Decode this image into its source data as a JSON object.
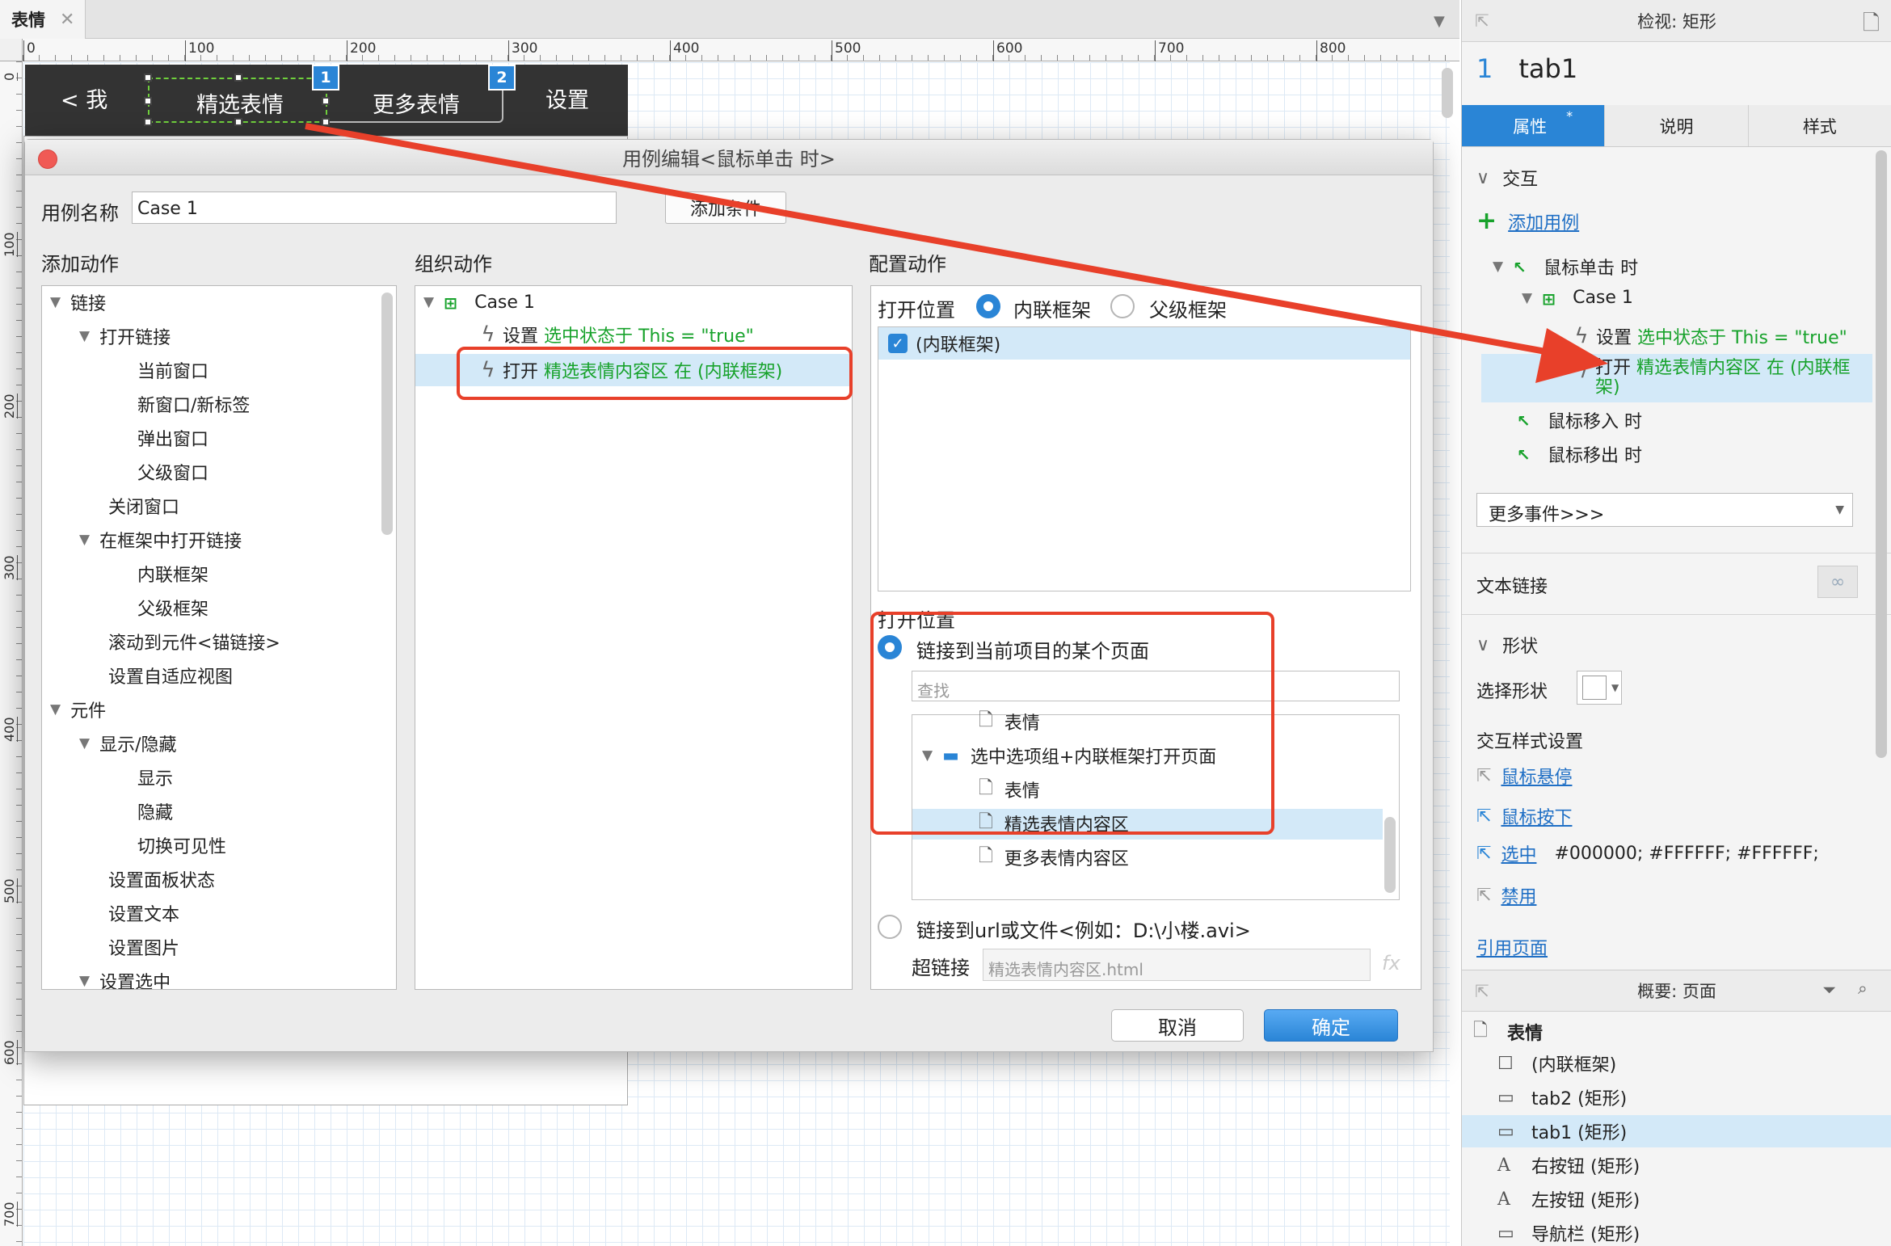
{
  "doc_tab": {
    "title": "表情",
    "close": "✕"
  },
  "ruler": {
    "h": [
      "0",
      "100",
      "200",
      "300",
      "400",
      "500",
      "600",
      "700",
      "800"
    ],
    "v": [
      "0",
      "100",
      "200",
      "300",
      "400",
      "500",
      "600",
      "700"
    ]
  },
  "navbar": {
    "back": "< 我",
    "tab1": "精选表情",
    "tab2": "更多表情",
    "settings": "设置",
    "badge1": "1",
    "badge2": "2"
  },
  "dialog": {
    "title": "用例编辑<鼠标单击 时>",
    "case_name_label": "用例名称",
    "case_name_value": "Case 1",
    "add_condition": "添加条件",
    "add_action_title": "添加动作",
    "org_action_title": "组织动作",
    "config_action_title": "配置动作",
    "add_actions": [
      {
        "label": "链接",
        "level": 0,
        "expanded": true
      },
      {
        "label": "打开链接",
        "level": 1,
        "expanded": true
      },
      {
        "label": "当前窗口",
        "level": 2
      },
      {
        "label": "新窗口/新标签",
        "level": 2
      },
      {
        "label": "弹出窗口",
        "level": 2
      },
      {
        "label": "父级窗口",
        "level": 2
      },
      {
        "label": "关闭窗口",
        "level": 1
      },
      {
        "label": "在框架中打开链接",
        "level": 1,
        "expanded": true
      },
      {
        "label": "内联框架",
        "level": 2
      },
      {
        "label": "父级框架",
        "level": 2
      },
      {
        "label": "滚动到元件<锚链接>",
        "level": 1
      },
      {
        "label": "设置自适应视图",
        "level": 1
      },
      {
        "label": "元件",
        "level": 0,
        "expanded": true
      },
      {
        "label": "显示/隐藏",
        "level": 1,
        "expanded": true
      },
      {
        "label": "显示",
        "level": 2
      },
      {
        "label": "隐藏",
        "level": 2
      },
      {
        "label": "切换可见性",
        "level": 2
      },
      {
        "label": "设置面板状态",
        "level": 1
      },
      {
        "label": "设置文本",
        "level": 1
      },
      {
        "label": "设置图片",
        "level": 1
      },
      {
        "label": "设置选中",
        "level": 1,
        "expanded": true
      }
    ],
    "org": {
      "case": "Case 1",
      "action1_verb": "设置",
      "action1_detail": "选中状态于 This = \"true\"",
      "action2_verb": "打开",
      "action2_detail": "精选表情内容区 在 (内联框架)"
    },
    "config": {
      "open_location_label": "打开位置",
      "opt_inline": "内联框架",
      "opt_parent": "父级框架",
      "frame_item": "(内联框架)",
      "open_location_label2": "打开位置",
      "link_page": "链接到当前项目的某个页面",
      "search_placeholder": "查找",
      "pages": [
        {
          "label": "表情",
          "type": "page",
          "level": 1
        },
        {
          "label": "选中选项组+内联框架打开页面",
          "type": "folder",
          "level": 0
        },
        {
          "label": "表情",
          "type": "page",
          "level": 1
        },
        {
          "label": "精选表情内容区",
          "type": "page",
          "level": 1,
          "selected": true
        },
        {
          "label": "更多表情内容区",
          "type": "page",
          "level": 1
        }
      ],
      "link_url": "链接到url或文件<例如：D:\\小楼.avi>",
      "hyperlink_label": "超链接",
      "hyperlink_placeholder": "精选表情内容区.html",
      "fx": "fx"
    },
    "cancel": "取消",
    "ok": "确定"
  },
  "inspector": {
    "title": "检视: 矩形",
    "num": "1",
    "name": "tab1",
    "tabs": [
      "属性",
      "说明",
      "样式"
    ],
    "tab_star": "*",
    "interaction": "交互",
    "add_case": "添加用例",
    "event_click": "鼠标单击 时",
    "case": "Case 1",
    "act1_verb": "设置",
    "act1_detail": "选中状态于 This = \"true\"",
    "act2_verb": "打开",
    "act2_detail": "精选表情内容区 在 (内联框架)",
    "event_enter": "鼠标移入 时",
    "event_leave": "鼠标移出 时",
    "more_events": "更多事件>>>",
    "text_link": "文本链接",
    "shape": "形状",
    "select_shape": "选择形状",
    "interaction_style": "交互样式设置",
    "hover": "鼠标悬停",
    "mousedown": "鼠标按下",
    "selected": "选中",
    "selected_values": "#000000; #FFFFFF; #FFFFFF;",
    "disabled": "禁用",
    "ref_page": "引用页面"
  },
  "outline": {
    "title": "概要: 页面",
    "items": [
      {
        "label": "表情",
        "icon": "page"
      },
      {
        "label": "(内联框架)",
        "icon": "frame"
      },
      {
        "label": "tab2 (矩形)",
        "icon": "rect"
      },
      {
        "label": "tab1 (矩形)",
        "icon": "rect",
        "selected": true
      },
      {
        "label": "右按钮 (矩形)",
        "icon": "text"
      },
      {
        "label": "左按钮 (矩形)",
        "icon": "text"
      },
      {
        "label": "导航栏 (矩形)",
        "icon": "rect"
      }
    ]
  },
  "colors": {
    "accent": "#2a85d6",
    "highlight": "#e8402a",
    "green": "#17a22b",
    "selection": "#d3e9f8"
  }
}
